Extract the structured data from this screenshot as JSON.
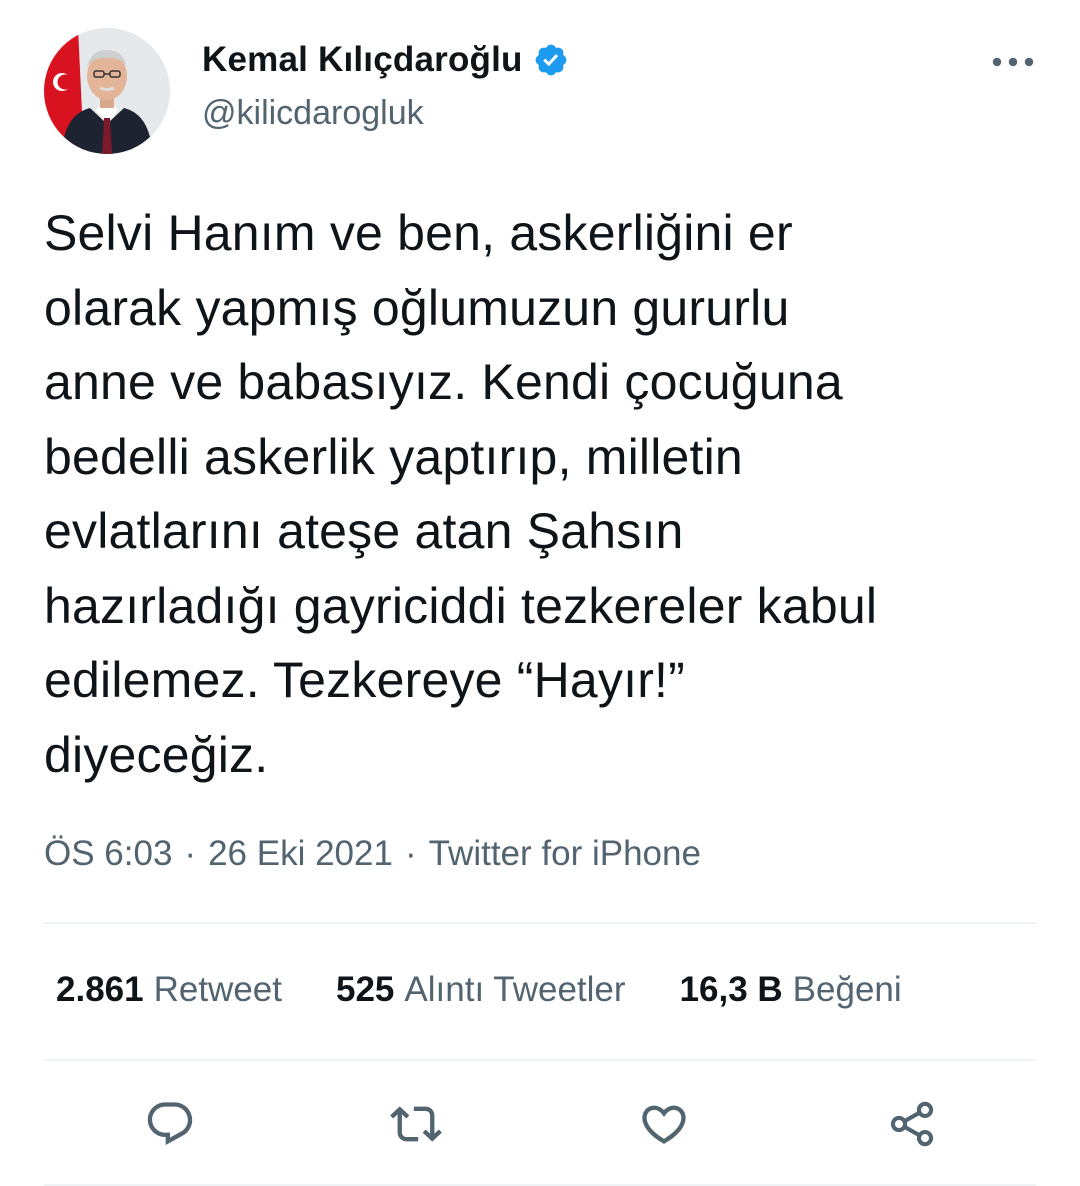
{
  "author": {
    "display_name": "Kemal Kılıçdaroğlu",
    "handle": "@kilicdarogluk",
    "verified_icon": "verified-badge-icon",
    "verified_color": "#1d9bf0"
  },
  "tweet": {
    "text": "Selvi Hanım ve ben, askerliğini er\nolarak yapmış oğlumuzun gururlu\nanne ve babasıyız. Kendi çocuğuna\nbedelli askerlik yaptırıp, milletin\nevlatlarını ateşe atan Şahsın\nhazırladığı gayriciddi tezkereler kabul\nedilemez. Tezkereye “Hayır!”\ndiyeceğiz.",
    "time": "ÖS 6:03",
    "separator": "·",
    "date": "26 Eki 2021",
    "source": "Twitter for iPhone"
  },
  "stats": {
    "retweets": {
      "count": "2.861",
      "label": "Retweet"
    },
    "quotes": {
      "count": "525",
      "label": "Alıntı Tweetler"
    },
    "likes": {
      "count": "16,3 B",
      "label": "Beğeni"
    }
  },
  "actions": [
    "reply-icon",
    "retweet-icon",
    "like-icon",
    "share-icon"
  ],
  "colors": {
    "text": "#0f1419",
    "secondary": "#536471",
    "divider": "#eff3f4",
    "accent": "#1d9bf0"
  }
}
